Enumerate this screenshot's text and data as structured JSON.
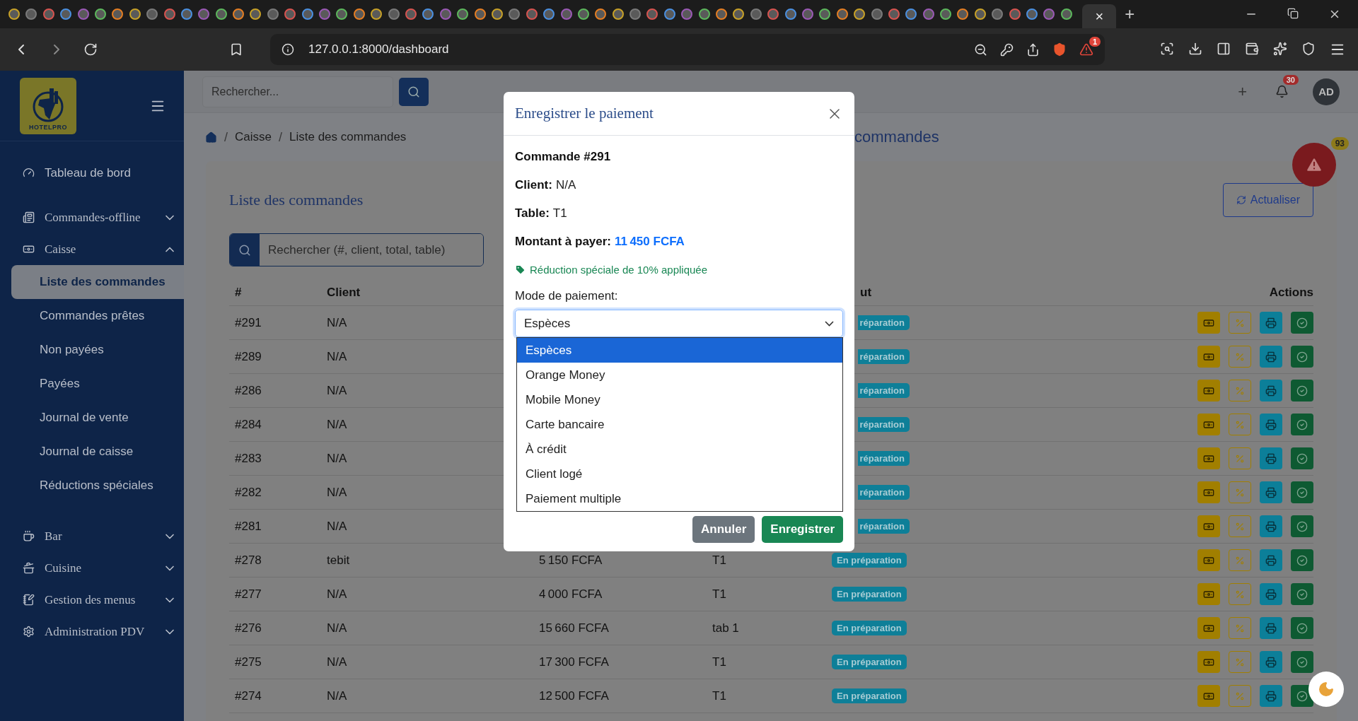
{
  "browser": {
    "active_tab_close": "×",
    "new_tab": "+",
    "url": "127.0.0.1:8000/dashboard",
    "rewards_badge": "1"
  },
  "sidebar": {
    "logo_text": "HOTELPRO",
    "items": [
      {
        "label": "Tableau de bord",
        "kind": "link"
      },
      {
        "label": "Commandes-offline",
        "kind": "group",
        "expanded": false
      },
      {
        "label": "Caisse",
        "kind": "group",
        "expanded": true,
        "children": [
          {
            "label": "Liste des commandes",
            "selected": true
          },
          {
            "label": "Commandes prêtes",
            "selected": false
          },
          {
            "label": "Non payées",
            "selected": false
          },
          {
            "label": "Payées",
            "selected": false
          },
          {
            "label": "Journal de vente",
            "selected": false
          },
          {
            "label": "Journal de caisse",
            "selected": false
          },
          {
            "label": "Réductions spéciales",
            "selected": false
          }
        ]
      },
      {
        "label": "Bar",
        "kind": "group",
        "expanded": false
      },
      {
        "label": "Cuisine",
        "kind": "group",
        "expanded": false
      },
      {
        "label": "Gestion des menus",
        "kind": "group",
        "expanded": false
      },
      {
        "label": "Administration PDV",
        "kind": "group",
        "expanded": false
      }
    ]
  },
  "topbar": {
    "search": {
      "placeholder": "Rechercher..."
    },
    "add": "+",
    "notifications_badge": "30",
    "avatar": "AD"
  },
  "breadcrumb": [
    {
      "kind": "separator",
      "text": "/"
    },
    {
      "kind": "link",
      "text": "Caisse"
    },
    {
      "kind": "separator",
      "text": "/"
    },
    {
      "kind": "link",
      "text": "Liste des commandes"
    }
  ],
  "page_heading": "commandes",
  "alert_badge": "93",
  "card": {
    "title": "Liste des commandes",
    "refresh_button": "Actualiser",
    "search": {
      "placeholder": "Rechercher (#, client, total, table)"
    },
    "table": {
      "header": {
        "number": "#",
        "client": "Client",
        "status": "ut",
        "actions": "Actions"
      },
      "rows": [
        {
          "number": "#291",
          "client": "N/A",
          "status": "réparation",
          "clipped": true
        },
        {
          "number": "#289",
          "client": "N/A",
          "status": "réparation",
          "clipped": true
        },
        {
          "number": "#286",
          "client": "N/A",
          "status": "réparation",
          "clipped": true
        },
        {
          "number": "#284",
          "client": "N/A",
          "status": "réparation",
          "clipped": true
        },
        {
          "number": "#283",
          "client": "N/A",
          "status": "réparation",
          "clipped": true
        },
        {
          "number": "#282",
          "client": "N/A",
          "status": "réparation",
          "clipped": true
        },
        {
          "number": "#281",
          "client": "N/A",
          "status": "réparation",
          "clipped": true
        },
        {
          "number": "#278",
          "client": "tebit",
          "total": "5 150 FCFA",
          "table": "T1",
          "status": "En préparation",
          "clipped": false
        },
        {
          "number": "#277",
          "client": "N/A",
          "total": "4 000 FCFA",
          "table": "T1",
          "status": "En préparation",
          "clipped": false
        },
        {
          "number": "#276",
          "client": "N/A",
          "total": "15 660 FCFA",
          "table": "tab 1",
          "status": "En préparation",
          "clipped": false
        },
        {
          "number": "#275",
          "client": "N/A",
          "total": "17 300 FCFA",
          "table": "T1",
          "status": "En préparation",
          "clipped": false
        },
        {
          "number": "#274",
          "client": "N/A",
          "total": "12 500 FCFA",
          "table": "T1",
          "status": "En préparation",
          "clipped": false
        }
      ]
    }
  },
  "modal": {
    "title": "Enregistrer le paiement",
    "order": "Commande #291",
    "fields": [
      {
        "label": "Client:",
        "value": "N/A",
        "kind": "plain"
      },
      {
        "label": "Table:",
        "value": "T1",
        "kind": "plain"
      },
      {
        "label": "Montant à payer:",
        "value": "11 450 FCFA",
        "kind": "amount"
      }
    ],
    "discount_note": "Réduction spéciale de 10% appliquée",
    "payment_label": "Mode de paiement:",
    "payment_select": {
      "value": "Espèces",
      "options": [
        {
          "label": "Espèces",
          "selected": true
        },
        {
          "label": "Orange Money",
          "selected": false
        },
        {
          "label": "Mobile Money",
          "selected": false
        },
        {
          "label": "Carte bancaire",
          "selected": false
        },
        {
          "label": "À crédit",
          "selected": false
        },
        {
          "label": "Client logé",
          "selected": false
        },
        {
          "label": "Paiement multiple",
          "selected": false
        }
      ]
    },
    "buttons": [
      {
        "label": "Annuler",
        "kind": "secondary"
      },
      {
        "label": "Enregistrer",
        "kind": "primary"
      }
    ]
  }
}
